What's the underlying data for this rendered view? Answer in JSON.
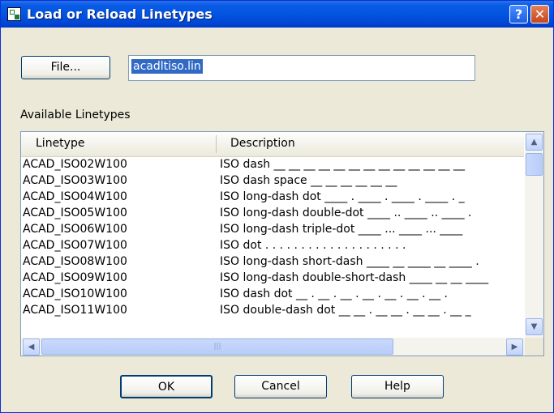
{
  "window": {
    "title": "Load or Reload Linetypes"
  },
  "title_buttons": {
    "help": "?",
    "close": "✕"
  },
  "file_button": {
    "label": "File..."
  },
  "filename": {
    "value": "acadltiso.lin"
  },
  "available_label": "Available Linetypes",
  "list": {
    "headers": {
      "linetype": "Linetype",
      "description": "Description"
    },
    "rows": [
      {
        "name": "ACAD_ISO02W100",
        "desc": "ISO dash __ __ __ __ __ __ __ __ __ __ __ __ __"
      },
      {
        "name": "ACAD_ISO03W100",
        "desc": "ISO dash space __    __    __    __    __    __"
      },
      {
        "name": "ACAD_ISO04W100",
        "desc": "ISO long-dash dot ____ . ____ . ____ . ____ . _"
      },
      {
        "name": "ACAD_ISO05W100",
        "desc": "ISO long-dash double-dot ____ .. ____ .. ____ ."
      },
      {
        "name": "ACAD_ISO06W100",
        "desc": "ISO long-dash triple-dot ____ ... ____ ... ____"
      },
      {
        "name": "ACAD_ISO07W100",
        "desc": "ISO dot . . . . . . . . . . . . . . . . . . . ."
      },
      {
        "name": "ACAD_ISO08W100",
        "desc": "ISO long-dash short-dash ____ __ ____ __ ____ ."
      },
      {
        "name": "ACAD_ISO09W100",
        "desc": "ISO long-dash double-short-dash ____ __ __ ____"
      },
      {
        "name": "ACAD_ISO10W100",
        "desc": "ISO dash dot __ . __ . __ . __ . __ . __ . __ ."
      },
      {
        "name": "ACAD_ISO11W100",
        "desc": "ISO double-dash dot __ __ . __ __ . __ __ . __ _"
      }
    ]
  },
  "buttons": {
    "ok": "OK",
    "cancel": "Cancel",
    "help": "Help"
  }
}
